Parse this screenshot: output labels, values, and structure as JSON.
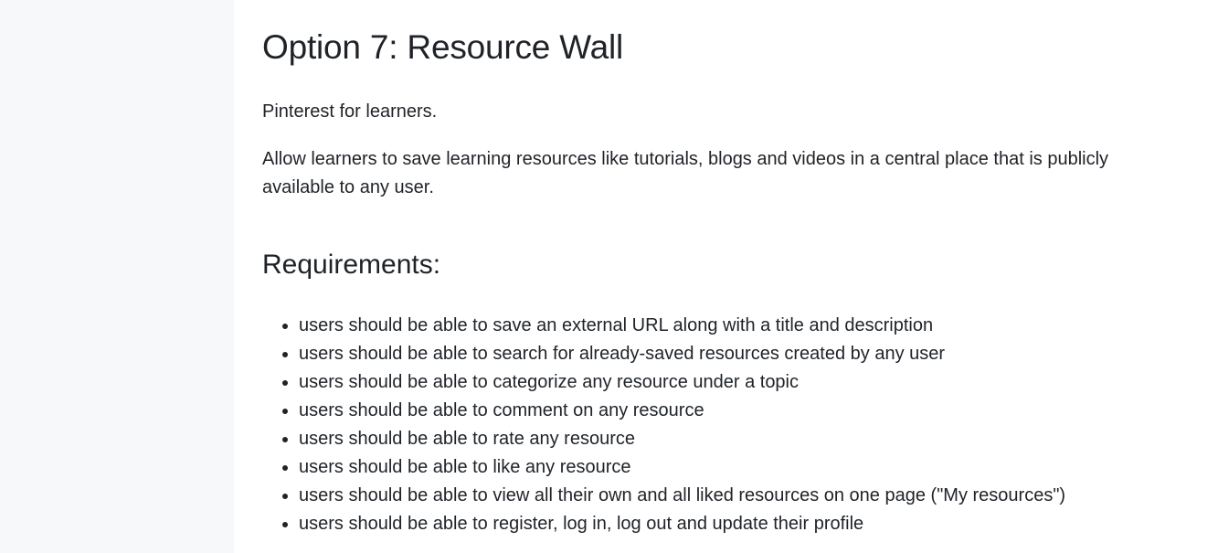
{
  "page": {
    "title": "Option 7: Resource Wall",
    "tagline": "Pinterest for learners.",
    "description": "Allow learners to save learning resources like tutorials, blogs and videos in a central place that is publicly available to any user.",
    "requirements_heading": "Requirements:",
    "requirements": [
      "users should be able to save an external URL along with a title and description",
      "users should be able to search for already-saved resources created by any user",
      "users should be able to categorize any resource under a topic",
      "users should be able to comment on any resource",
      "users should be able to rate any resource",
      "users should be able to like any resource",
      "users should be able to view all their own and all liked resources on one page (\"My resources\")",
      "users should be able to register, log in, log out and update their profile"
    ]
  }
}
